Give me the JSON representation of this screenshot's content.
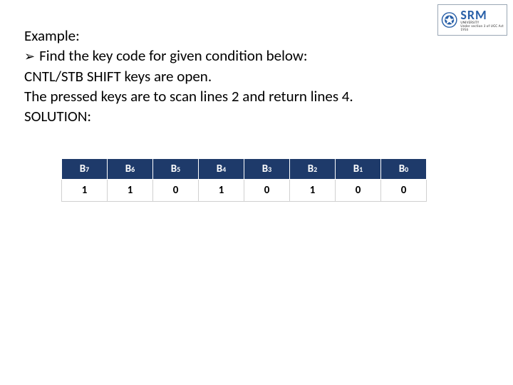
{
  "logo": {
    "brand": "SRM",
    "subtitle": "UNIVERSITY",
    "tagline": "Under section 3 of UGC Act 1956"
  },
  "text": {
    "example": "Example:",
    "find": "Find the key code for given condition below:",
    "cntl": "CNTL/STB SHIFT keys are open.",
    "pressed": "The pressed keys are  to scan lines 2 and return lines 4.",
    "solution": "SOLUTION:"
  },
  "bits": [
    {
      "label_b": "B",
      "label_s": "7",
      "value": "1"
    },
    {
      "label_b": "B",
      "label_s": "6",
      "value": "1"
    },
    {
      "label_b": "B",
      "label_s": "5",
      "value": "0"
    },
    {
      "label_b": "B",
      "label_s": "4",
      "value": "1"
    },
    {
      "label_b": "B",
      "label_s": "3",
      "value": "0"
    },
    {
      "label_b": "B",
      "label_s": "2",
      "value": "1"
    },
    {
      "label_b": "B",
      "label_s": "1",
      "value": "0"
    },
    {
      "label_b": "B",
      "label_s": "0",
      "value": "0"
    }
  ]
}
